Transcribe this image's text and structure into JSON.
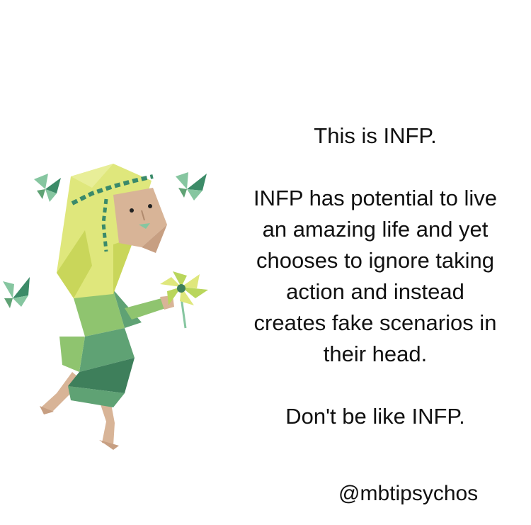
{
  "post": {
    "title_line": "This is INFP.",
    "body_lines": [
      "INFP has potential to live",
      "an amazing life and yet",
      "chooses to ignore taking",
      "action and instead",
      "creates fake scenarios in",
      "their head."
    ],
    "closing_line": "Don't be like INFP.",
    "handle": "@mbtipsychos"
  },
  "illustration": {
    "icon": "dancing-girl-with-flower-icon",
    "colors": {
      "hair": "#dfe77c",
      "hair_dark": "#c9d65a",
      "skin": "#d8b497",
      "dress_light": "#8fc46f",
      "dress_mid": "#5fa274",
      "dress_dark": "#3e7f5b",
      "headband": "#3a8a6a",
      "flower": "#b9d65c",
      "butterfly_light": "#86c6a0",
      "butterfly_dark": "#3c8b68"
    }
  }
}
